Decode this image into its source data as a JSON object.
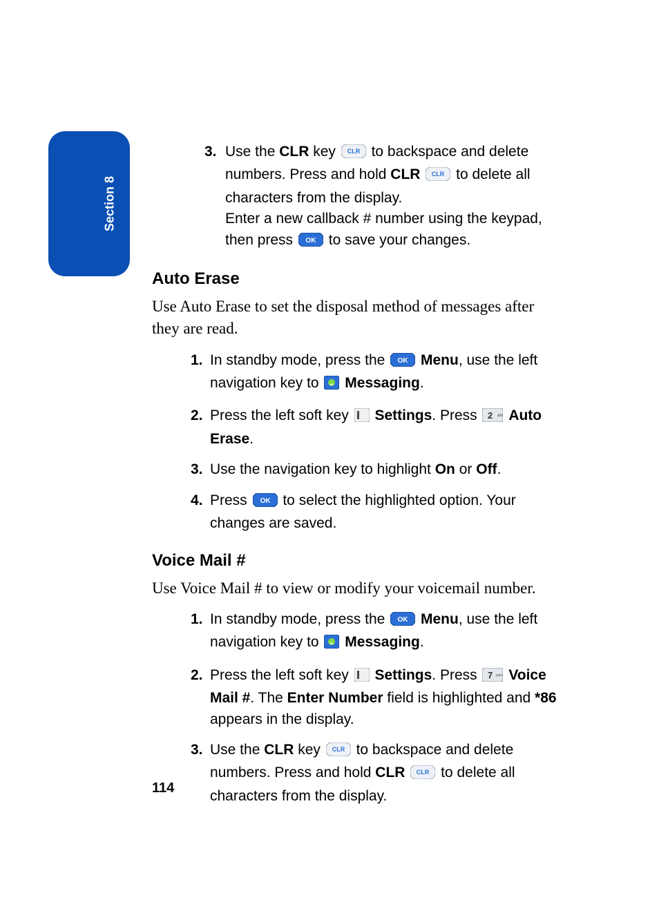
{
  "section_tab": "Section 8",
  "page_number": "114",
  "top_list": {
    "item3_num": "3.",
    "item3_a": "Use the ",
    "item3_clr1": "CLR",
    "item3_b": " key ",
    "item3_c": " to backspace and delete numbers. Press and hold ",
    "item3_clr2": "CLR",
    "item3_d": " ",
    "item3_e": " to delete all characters from the display.",
    "item3_f": "Enter a new callback # number using the keypad, then press ",
    "item3_g": " to save your changes."
  },
  "auto_erase": {
    "heading": "Auto Erase",
    "intro": "Use Auto Erase to set the disposal method of messages after they are read.",
    "steps": {
      "s1_num": "1.",
      "s1_a": "In standby mode, press the ",
      "s1_menu": "Menu",
      "s1_b": ", use the left navigation key to ",
      "s1_msg": "Messaging",
      "s1_c": ".",
      "s2_num": "2.",
      "s2_a": "Press the left soft key ",
      "s2_settings": "Settings",
      "s2_b": ". Press ",
      "s2_auto": "Auto Erase",
      "s2_c": ".",
      "s3_num": "3.",
      "s3_a": "Use the navigation key to highlight ",
      "s3_on": "On",
      "s3_b": " or ",
      "s3_off": "Off",
      "s3_c": ".",
      "s4_num": "4.",
      "s4_a": "Press ",
      "s4_b": " to select the highlighted option. Your changes are saved."
    }
  },
  "voice_mail": {
    "heading": "Voice Mail #",
    "intro": "Use Voice Mail # to view or modify your voicemail number.",
    "steps": {
      "s1_num": "1.",
      "s1_a": "In standby mode, press the ",
      "s1_menu": "Menu",
      "s1_b": ", use the left navigation key to ",
      "s1_msg": "Messaging",
      "s1_c": ".",
      "s2_num": "2.",
      "s2_a": "Press the left soft key ",
      "s2_settings": "Settings",
      "s2_b": ". Press ",
      "s2_vm": "Voice Mail #",
      "s2_c": ". The ",
      "s2_enter": "Enter Number",
      "s2_d": " field is highlighted and ",
      "s2_star86": "*86",
      "s2_e": " appears in the display.",
      "s3_num": "3.",
      "s3_a": "Use the ",
      "s3_clr1": "CLR",
      "s3_b": " key ",
      "s3_c": " to backspace and delete numbers. Press and hold ",
      "s3_clr2": "CLR",
      "s3_d": " ",
      "s3_e": " to delete all characters from the display."
    }
  }
}
